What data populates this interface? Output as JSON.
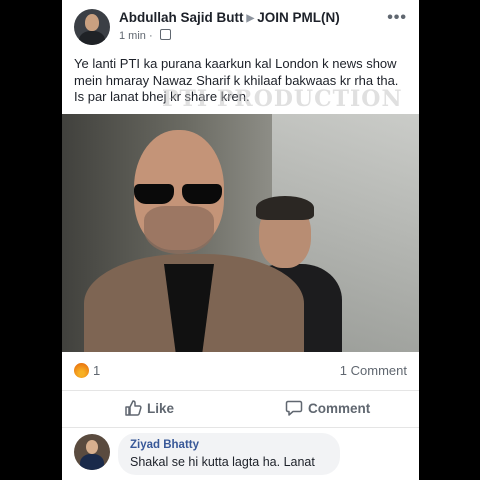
{
  "post": {
    "author": "Abdullah Sajid Butt",
    "group": "JOIN PML(N)",
    "time": "1 min",
    "text": "Ye lanti PTI ka purana kaarkun kal London k news show mein hmaray Nawaz Sharif k khilaaf bakwaas kr rha tha. Is par lanat bhej kr share kren.",
    "watermark": "PTI PRODUCTION"
  },
  "stats": {
    "reaction_icon": "angry-reaction-icon",
    "reaction_count": "1",
    "comment_count": "1 Comment"
  },
  "actions": {
    "like_label": "Like",
    "comment_label": "Comment"
  },
  "comment": {
    "author": "Ziyad Bhatty",
    "text": "Shakal se hi kutta lagta ha. Lanat"
  },
  "colors": {
    "link_blue": "#385898",
    "text_dark": "#1d2129",
    "text_grey": "#606770"
  }
}
